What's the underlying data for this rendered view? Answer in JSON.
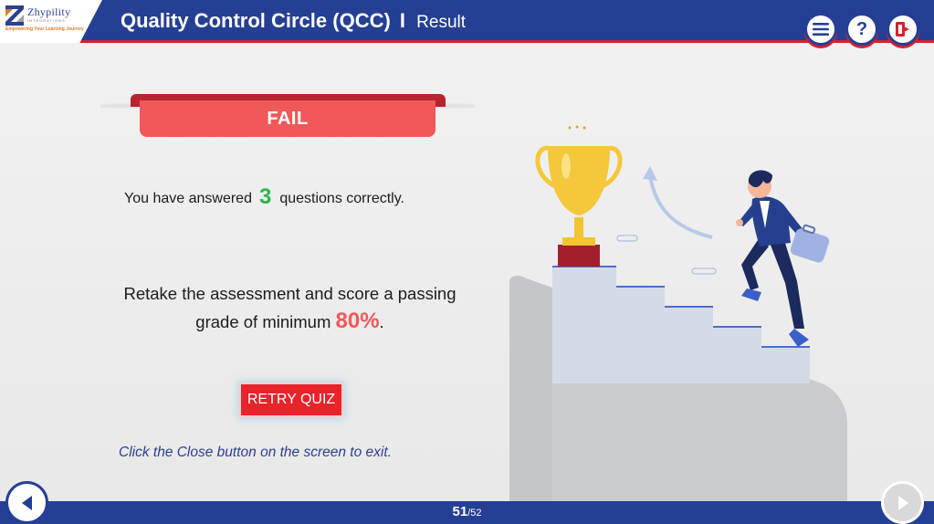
{
  "header": {
    "logo": {
      "name": "Zhypility",
      "sub": "INTEGRATIONS",
      "tagline": "Empowering Your Learning Journey"
    },
    "title": "Quality Control Circle (QCC)",
    "separator": "I",
    "subtitle": "Result",
    "buttons": {
      "menu_icon": "hamburger-menu-icon",
      "help_glyph": "?",
      "exit_icon": "exit-door-icon"
    }
  },
  "result": {
    "status": "FAIL",
    "answered_prefix": "You have answered",
    "correct_count": "3",
    "answered_suffix": "questions correctly.",
    "retake_text": "Retake the assessment and score a passing grade of minimum",
    "passing_grade": "80%",
    "retake_end": ".",
    "retry_label": "RETRY QUIZ",
    "exit_note": "Click the Close button on the screen to exit."
  },
  "footer": {
    "current_page": "51",
    "total_pages": "/52",
    "prev_icon": "chevron-left-icon",
    "next_icon": "chevron-right-icon"
  },
  "colors": {
    "header_blue": "#243f94",
    "accent_red": "#d8202f",
    "fail_red": "#f0585a",
    "correct_green": "#2eb54a",
    "retry_red": "#e8232a"
  }
}
